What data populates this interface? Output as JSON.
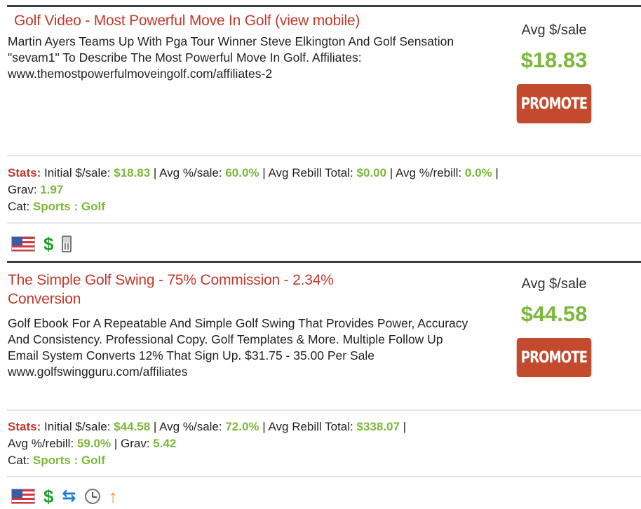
{
  "listings": [
    {
      "title": "Golf Video - Most Powerful Move In Golf (view mobile)",
      "description": "Martin Ayers Teams Up With Pga Tour Winner Steve Elkington And Golf Sensation \"sevam1\" To Describe The Most Powerful Move In Golf. Affiliates: www.themostpowerfulmoveingolf.com/affiliates-2",
      "avg_label": "Avg $/sale",
      "avg_value": "$18.83",
      "promote_label": "PROMOTE",
      "stats": {
        "label": "Stats:",
        "initial_label": "Initial $/sale:",
        "initial": "$18.83",
        "avg_pct_label": "Avg %/sale:",
        "avg_pct": "60.0%",
        "rebill_total_label": "Avg Rebill Total:",
        "rebill_total": "$0.00",
        "rebill_pct_label": "Avg %/rebill:",
        "rebill_pct": "0.0%",
        "grav_label": "Grav:",
        "grav": "1.97",
        "cat_label": "Cat:",
        "cat": "Sports : Golf"
      },
      "icons": [
        "us-flag-icon",
        "dollar-icon",
        "mobile-phone-icon"
      ]
    },
    {
      "title": "The Simple Golf Swing - 75% Commission - 2.34% Conversion",
      "title_line1": "The Simple Golf Swing - 75% Commission - 2.34%",
      "title_line2": "Conversion",
      "description": "Golf Ebook For A Repeatable And Simple Golf Swing That Provides Power, Accuracy And Consistency. Professional Copy. Golf Templates & More. Multiple Follow Up Email System Converts 12% That Sign Up. $31.75 - 35.00 Per Sale www.golfswingguru.com/affiliates",
      "avg_label": "Avg $/sale",
      "avg_value": "$44.58",
      "promote_label": "PROMOTE",
      "stats": {
        "label": "Stats:",
        "initial_label": "Initial $/sale:",
        "initial": "$44.58",
        "avg_pct_label": "Avg %/sale:",
        "avg_pct": "72.0%",
        "rebill_total_label": "Avg Rebill Total:",
        "rebill_total": "$338.07",
        "rebill_pct_label": "Avg %/rebill:",
        "rebill_pct": "59.0%",
        "grav_label": "Grav:",
        "grav": "5.42",
        "cat_label": "Cat:",
        "cat": "Sports : Golf"
      },
      "icons": [
        "us-flag-icon",
        "dollar-icon",
        "recurring-billing-icon",
        "clock-icon",
        "up-arrow-icon"
      ]
    }
  ],
  "colors": {
    "title": "#c0392b",
    "value_green": "#7bb83a",
    "button": "#c34a2c",
    "rule": "#3a3f44"
  }
}
